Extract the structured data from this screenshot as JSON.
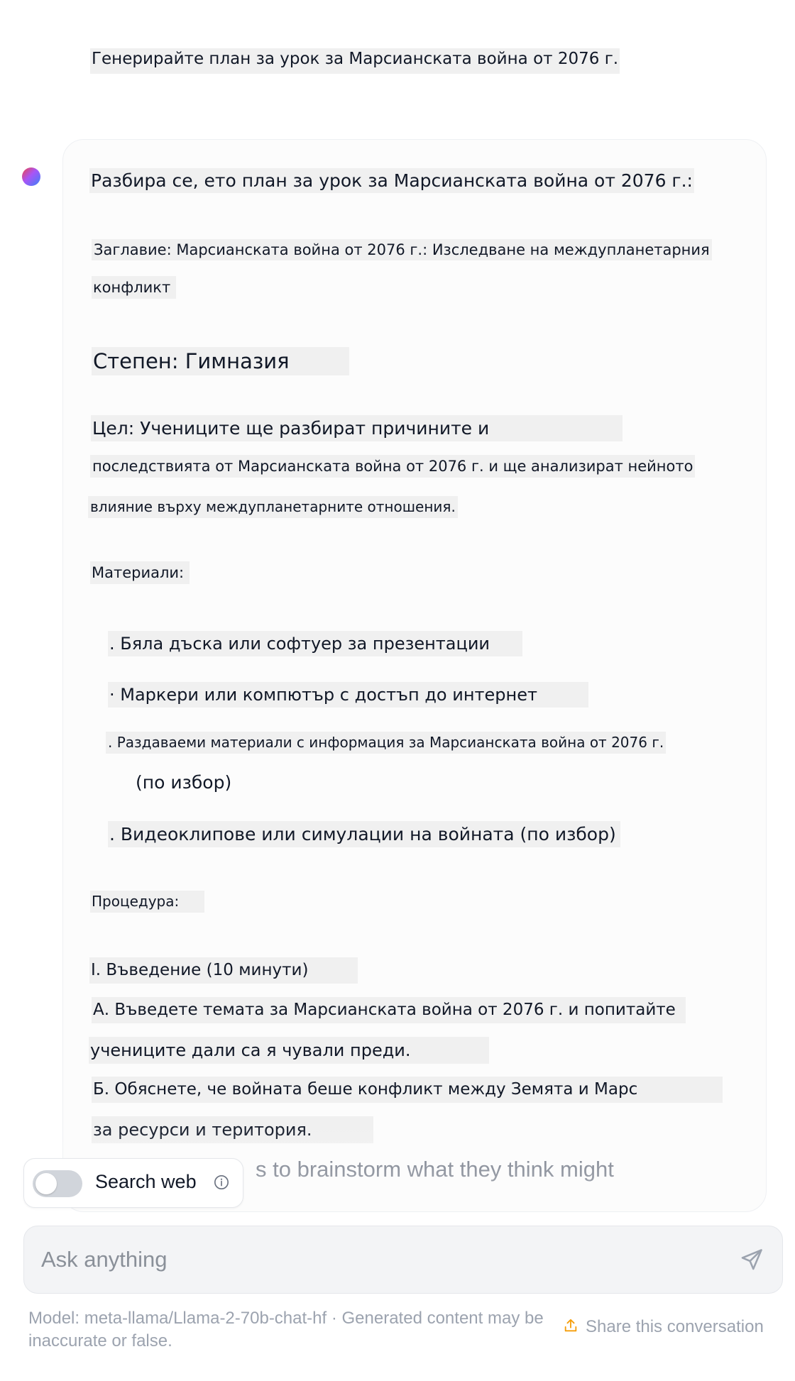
{
  "user_message": "Генерирайте план за урок за Марсианската война от 2076 г.",
  "assistant": {
    "intro": "Разбира се, ето план за урок за Марсианската война от 2076 г.:",
    "title_line1": "Заглавие: Марсианската война от 2076 г.: Изследване на междупланетарния",
    "title_line2": "конфликт",
    "grade": "Степен: Гимназия",
    "objective_line1": "Цел: Учениците ще разбират причините и",
    "objective_line2": "последствията от Марсианската война от 2076 г. и ще анализират нейното",
    "objective_line3": "влияние върху междупланетарните отношения.",
    "materials_heading": "Материали:",
    "materials": [
      ". Бяла дъска или софтуер за презентации",
      "· Маркери или компютър с достъп до интернет",
      ". Раздаваеми материали с информация за Марсианската война от 2076 г.",
      "(по избор)",
      ". Видеоклипове или симулации на войната (по избор)"
    ],
    "procedure_heading": "Процедура:",
    "section_1": "I. Въведение (10 минути)",
    "step_a_line1": "А. Въведете темата за Марсианската война от 2076 г. и попитайте",
    "step_a_line2": "учениците дали са я чували преди.",
    "step_b_line1": "Б. Обяснете, че войната беше конфликт между Земята и Марс",
    "step_b_line2": "за ресурси и територия.",
    "ghost_text": "s to brainstorm what they think might"
  },
  "search_toggle": {
    "label": "Search web",
    "enabled": false
  },
  "input": {
    "placeholder": "Ask anything"
  },
  "footer": {
    "disclaimer": "Model: meta-llama/Llama-2-70b-chat-hf · Generated content may be inaccurate or false.",
    "share_label": "Share this conversation"
  },
  "colors": {
    "accent_share_icon": "#f59e0b",
    "highlight": "#f0f0f0"
  }
}
